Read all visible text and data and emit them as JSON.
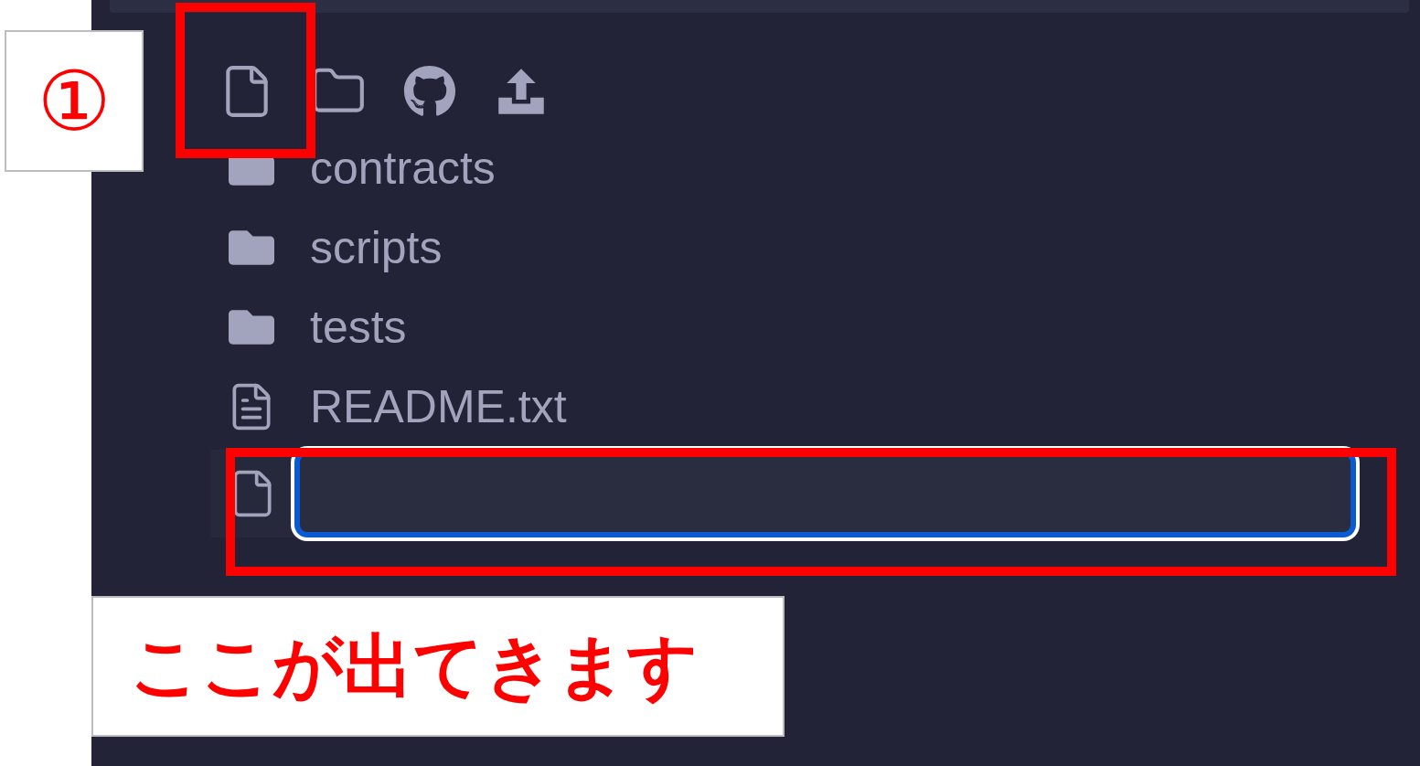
{
  "toolbar": [
    {
      "kind": "new-file"
    },
    {
      "kind": "new-folder"
    },
    {
      "kind": "github"
    },
    {
      "kind": "upload"
    }
  ],
  "tree": [
    {
      "kind": "folder",
      "name": "contracts"
    },
    {
      "kind": "folder",
      "name": "scripts"
    },
    {
      "kind": "folder",
      "name": "tests"
    },
    {
      "kind": "file",
      "name": "README.txt"
    }
  ],
  "new_file_input": {
    "focused": true
  },
  "annotations": {
    "step_badge": "①",
    "callout": "ここが出てきます"
  }
}
